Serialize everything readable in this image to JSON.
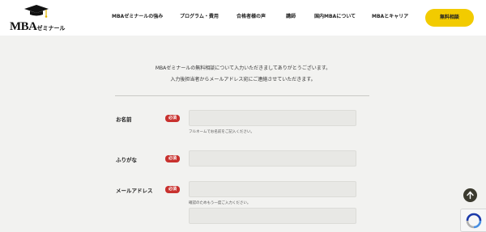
{
  "header": {
    "logo": {
      "main": "MBA",
      "sub": "ゼミナール"
    },
    "nav": [
      "MBAゼミナールの強み",
      "プログラム・費用",
      "合格者様の声",
      "講師",
      "国内MBAについて",
      "MBAとキャリア"
    ],
    "cta_label": "無料相談",
    "cta_color": "#f2cb00"
  },
  "intro": {
    "line1": "MBAゼミナールの無料相談について入力いただきましてありがとうございます。",
    "line2": "入力後担当者からメールアドレス宛にご連絡させていただきます。"
  },
  "form": {
    "required_label": "必須",
    "required_color": "#c8312e",
    "name": {
      "label": "お名前",
      "value": "",
      "hint": "フルネームでお名前をご記入ください。"
    },
    "furigana": {
      "label": "ふりがな",
      "value": ""
    },
    "email": {
      "label": "メールアドレス",
      "value": "",
      "hint": "確認のためもう一度ご入力ください。",
      "confirm_value": ""
    }
  },
  "icons": {
    "scroll_top": "arrow-up-icon",
    "recaptcha": "recaptcha-icon",
    "logo": "graduation-cap-icon"
  }
}
